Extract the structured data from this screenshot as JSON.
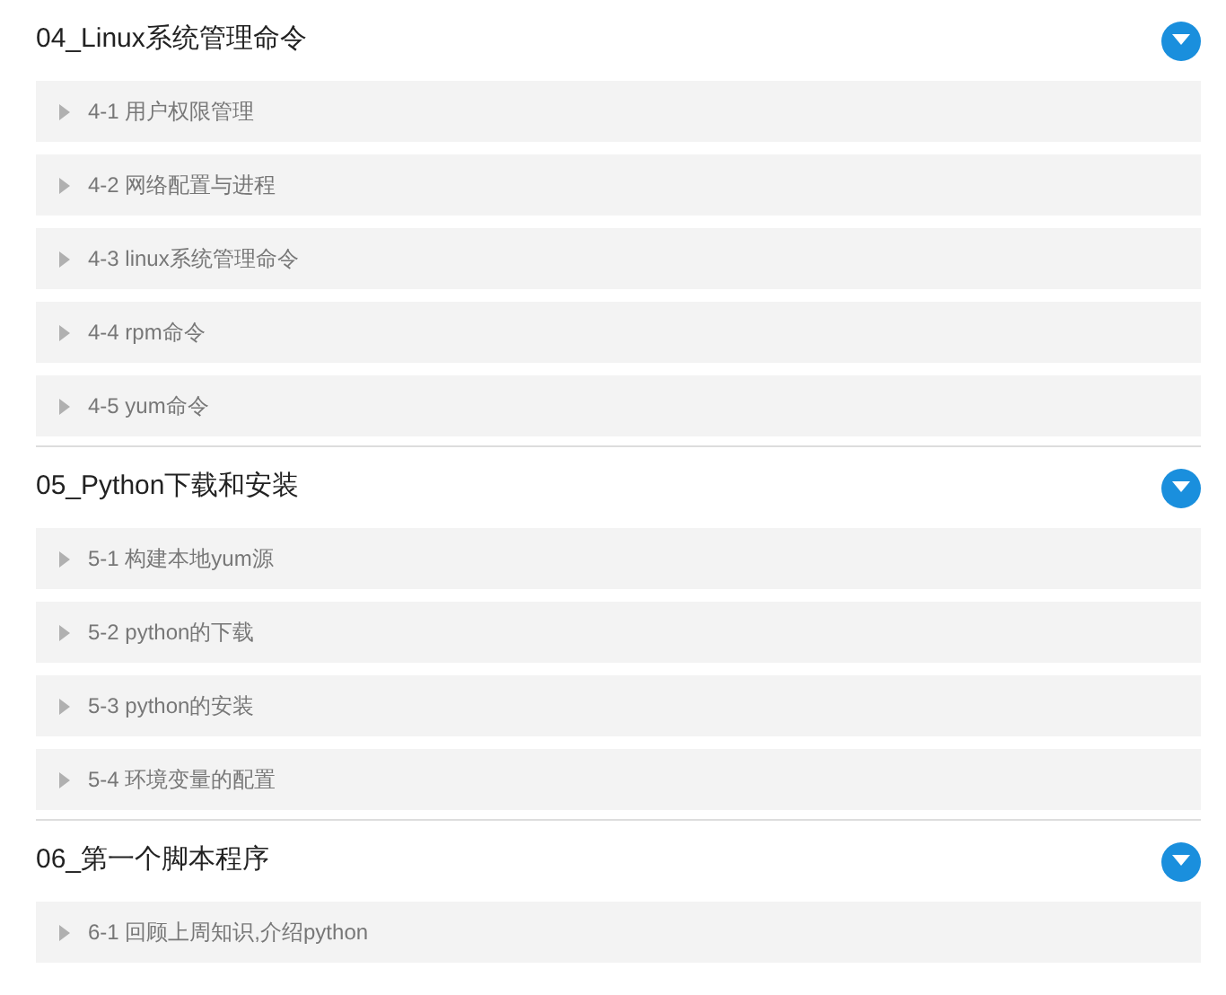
{
  "sections": [
    {
      "title": "04_Linux系统管理命令",
      "expanded": true,
      "items": [
        {
          "label": "4-1 用户权限管理"
        },
        {
          "label": "4-2 网络配置与进程"
        },
        {
          "label": "4-3 linux系统管理命令"
        },
        {
          "label": "4-4 rpm命令"
        },
        {
          "label": "4-5 yum命令"
        }
      ]
    },
    {
      "title": "05_Python下载和安装",
      "expanded": true,
      "items": [
        {
          "label": "5-1 构建本地yum源"
        },
        {
          "label": "5-2 python的下载"
        },
        {
          "label": "5-3 python的安装"
        },
        {
          "label": "5-4 环境变量的配置"
        }
      ]
    },
    {
      "title": "06_第一个脚本程序",
      "expanded": true,
      "items": [
        {
          "label": "6-1 回顾上周知识,介绍python"
        }
      ]
    }
  ]
}
